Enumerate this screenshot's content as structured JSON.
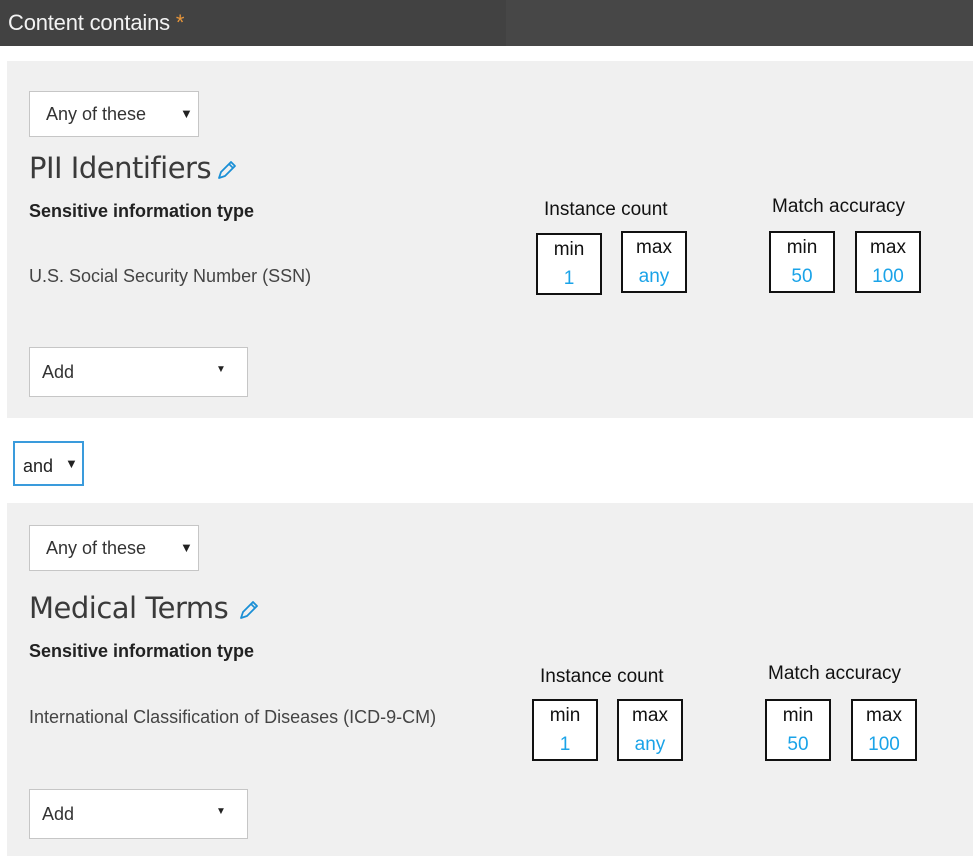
{
  "header": {
    "title": "Content contains",
    "required_mark": "*"
  },
  "groups": [
    {
      "match_mode": "Any of these",
      "name": "PII Identifiers",
      "column_header": "Sensitive information type",
      "rows": [
        {
          "type": "U.S. Social Security Number (SSN)",
          "instance_count_label": "Instance count",
          "instance_min_label": "min",
          "instance_min": "1",
          "instance_max_label": "max",
          "instance_max": "any",
          "match_accuracy_label": "Match accuracy",
          "accuracy_min_label": "min",
          "accuracy_min": "50",
          "accuracy_max_label": "max",
          "accuracy_max": "100"
        }
      ],
      "add_label": "Add"
    },
    {
      "match_mode": "Any of these",
      "name": "Medical Terms",
      "column_header": "Sensitive information type",
      "rows": [
        {
          "type": "International Classification of Diseases (ICD-9-CM)",
          "instance_count_label": "Instance count",
          "instance_min_label": "min",
          "instance_min": "1",
          "instance_max_label": "max",
          "instance_max": "any",
          "match_accuracy_label": "Match accuracy",
          "accuracy_min_label": "min",
          "accuracy_min": "50",
          "accuracy_max_label": "max",
          "accuracy_max": "100"
        }
      ],
      "add_label": "Add"
    }
  ],
  "operator": "and",
  "icons": {
    "dropdown": "caret-down-icon",
    "edit": "pencil-icon"
  },
  "colors": {
    "header_bg": "#474747",
    "accent_blue": "#1aa3e8",
    "required_orange": "#e8963a",
    "panel_bg": "#f0f0f0"
  }
}
